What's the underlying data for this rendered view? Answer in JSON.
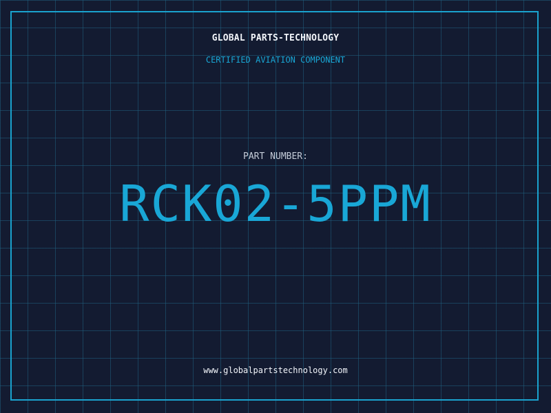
{
  "header": {
    "brand": "GLOBAL PARTS-TECHNOLOGY",
    "subtitle": "CERTIFIED AVIATION COMPONENT"
  },
  "part": {
    "label": "PART NUMBER:",
    "number": "RCK02-5PPM"
  },
  "footer": {
    "website": "www.globalpartstechnology.com"
  },
  "colors": {
    "background": "#131b31",
    "grid": "#1e6080",
    "accent": "#19a7d6",
    "text": "#f2f5fa",
    "muted_text": "#c4ccd8"
  }
}
